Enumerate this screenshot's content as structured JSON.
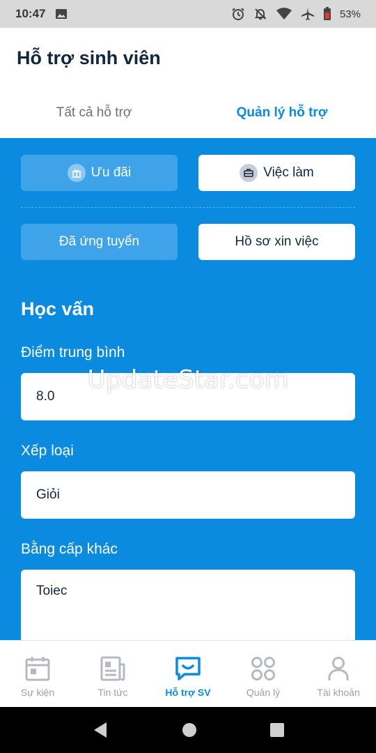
{
  "status_bar": {
    "time": "10:47",
    "battery": "53%",
    "icons": [
      "image-icon",
      "alarm-icon",
      "notifications-off-icon",
      "wifi-icon",
      "airplane-icon",
      "battery-icon"
    ]
  },
  "header": {
    "title": "Hỗ trợ sinh viên",
    "tabs": [
      {
        "label": "Tất cả hỗ trợ",
        "active": false
      },
      {
        "label": "Quản lý hỗ trợ",
        "active": true
      }
    ]
  },
  "actions": {
    "uu_dai": "Ưu đãi",
    "viec_lam": "Việc làm",
    "da_ung_tuyen": "Đã ứng tuyển",
    "ho_so": "Hồ sơ xin việc"
  },
  "education": {
    "title": "Học vấn",
    "gpa_label": "Điểm trung bình",
    "gpa_value": "8.0",
    "rank_label": "Xếp loại",
    "rank_value": "Giỏi",
    "cert_label": "Bằng cấp khác",
    "cert_value": "Toiec"
  },
  "watermark": "UpdateStar.com",
  "bottom_nav": [
    {
      "label": "Sự kiện",
      "icon": "calendar-icon",
      "active": false
    },
    {
      "label": "Tin tức",
      "icon": "newspaper-icon",
      "active": false
    },
    {
      "label": "Hỗ trợ SV",
      "icon": "chat-icon",
      "active": true
    },
    {
      "label": "Quản lý",
      "icon": "grid-icon",
      "active": false
    },
    {
      "label": "Tài khoản",
      "icon": "user-icon",
      "active": false
    }
  ],
  "colors": {
    "primary": "#0a8be0",
    "button_light": "#3fa3ea",
    "title_dark": "#12263f",
    "inactive_gray": "#9aa0a8"
  }
}
